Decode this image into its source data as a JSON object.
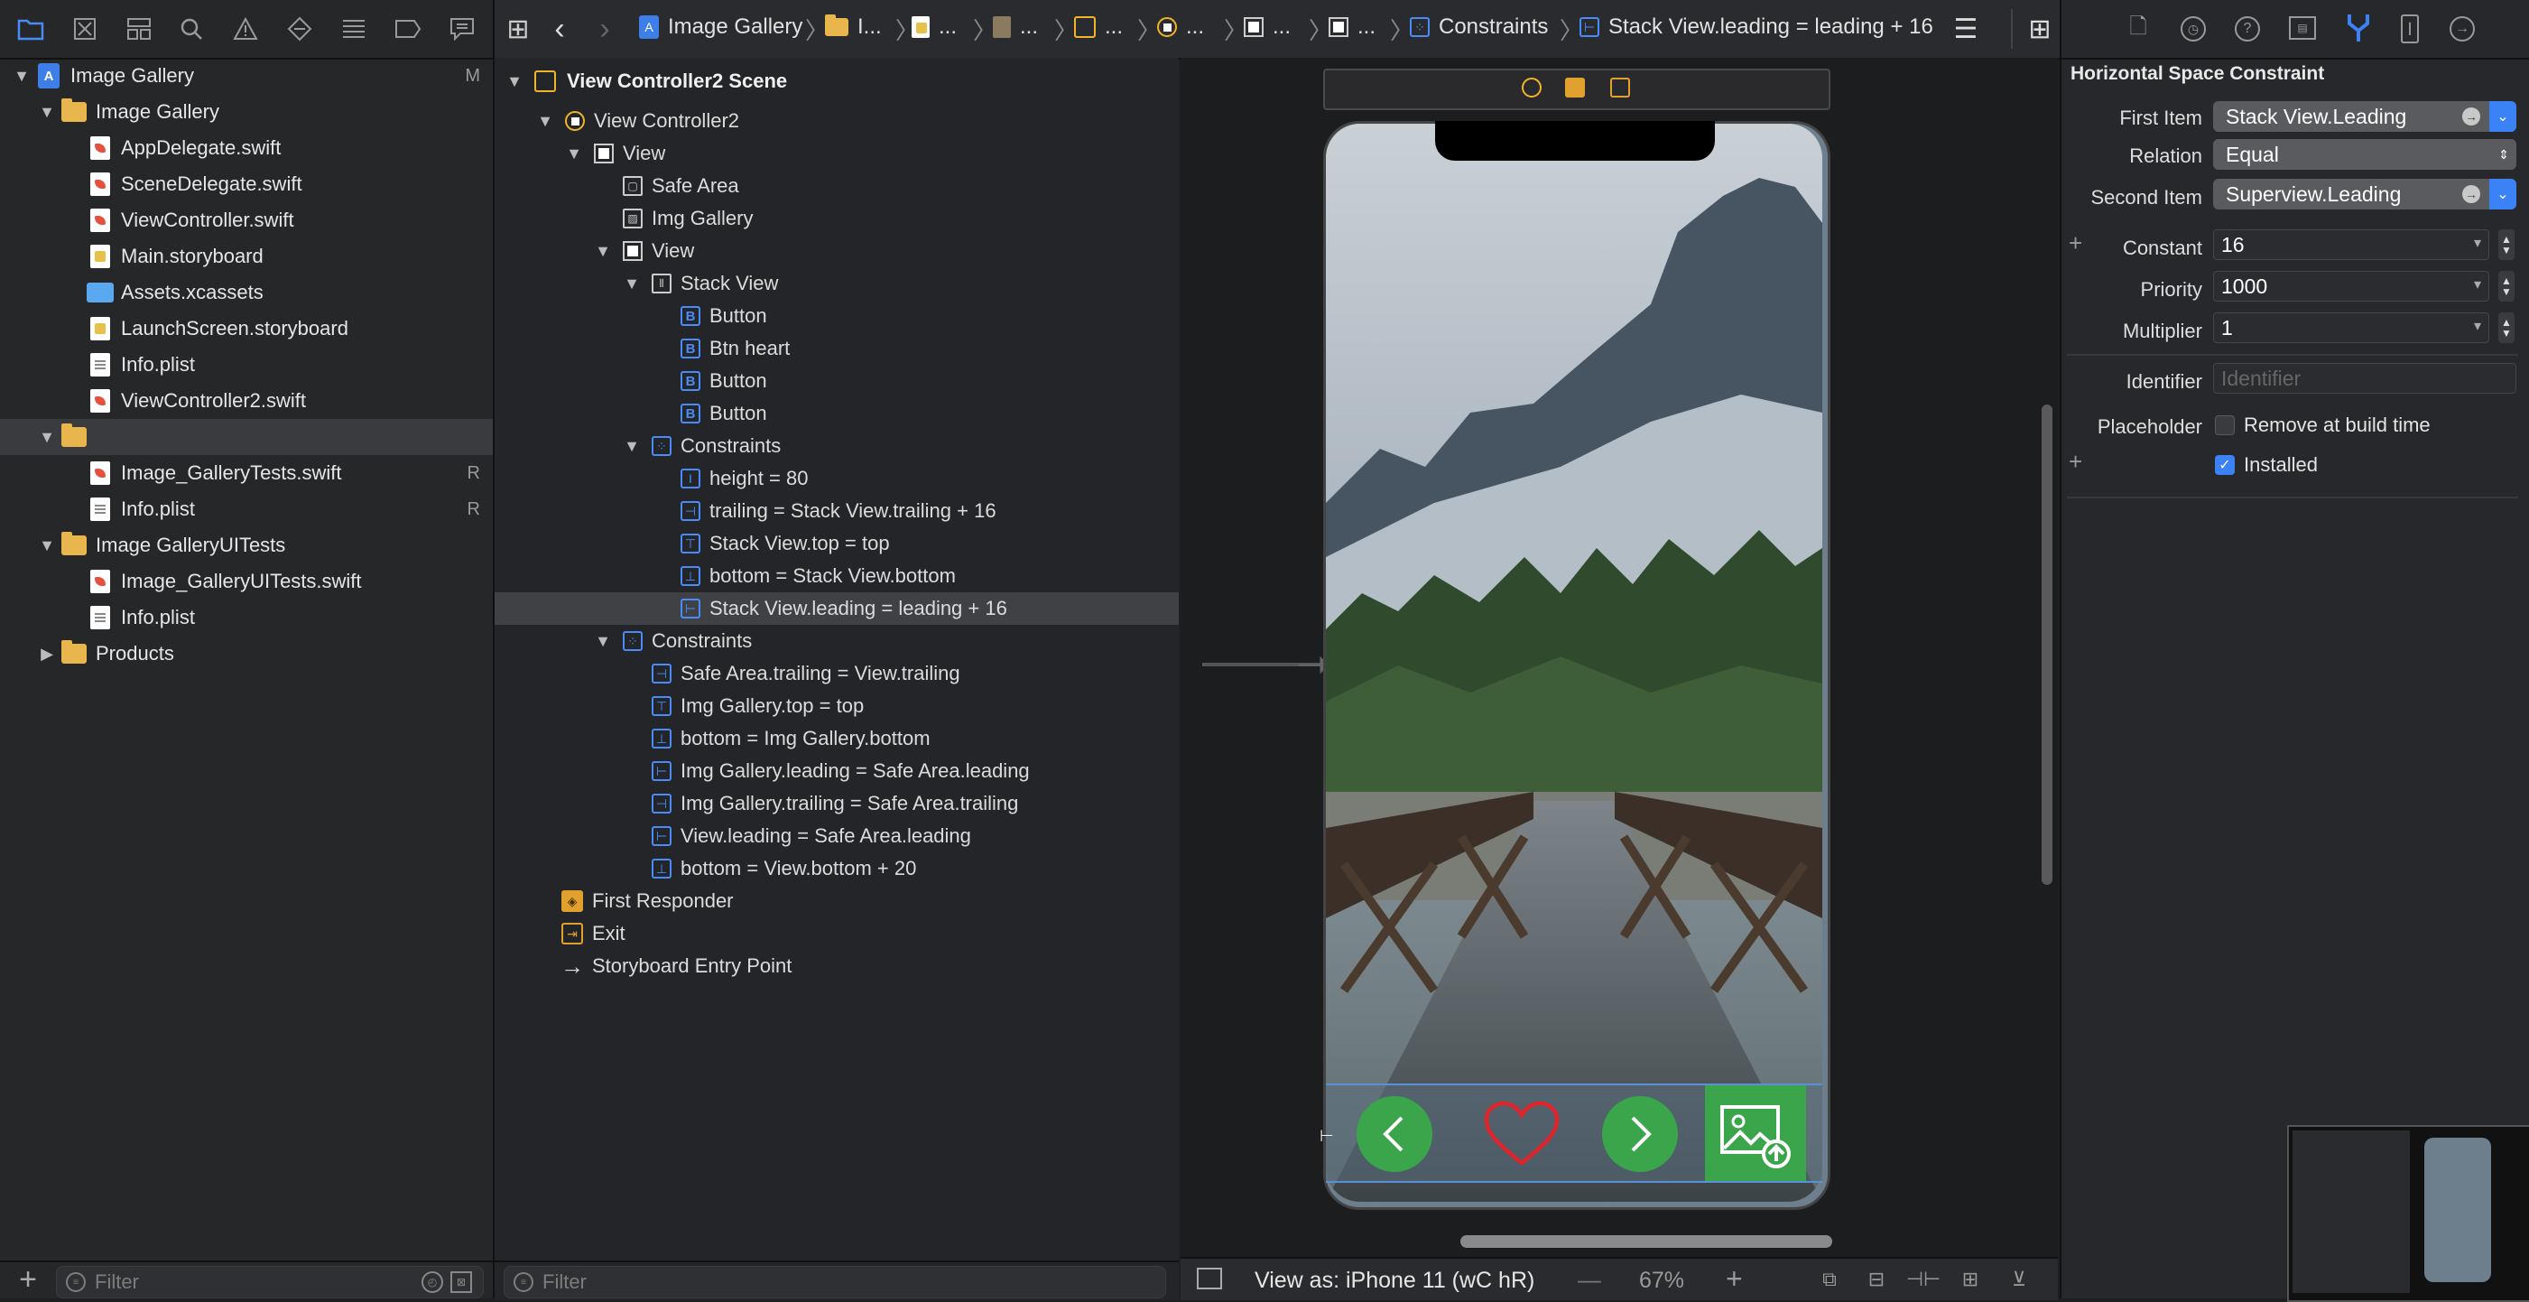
{
  "navigator": {
    "toolbar_icons": [
      "folder-icon",
      "source-control-icon",
      "symbol-icon",
      "find-icon",
      "issue-icon",
      "test-icon",
      "debug-icon",
      "breakpoint-icon",
      "report-icon"
    ],
    "items": [
      {
        "label": "Image Gallery",
        "badge": "M",
        "type": "project"
      },
      {
        "label": "Image Gallery",
        "badge": "",
        "type": "folder"
      },
      {
        "label": "AppDelegate.swift",
        "badge": "",
        "type": "swift"
      },
      {
        "label": "SceneDelegate.swift",
        "badge": "",
        "type": "swift"
      },
      {
        "label": "ViewController.swift",
        "badge": "",
        "type": "swift"
      },
      {
        "label": "Main.storyboard",
        "badge": "",
        "type": "storyboard"
      },
      {
        "label": "Assets.xcassets",
        "badge": "",
        "type": "assets"
      },
      {
        "label": "LaunchScreen.storyboard",
        "badge": "",
        "type": "storyboard"
      },
      {
        "label": "Info.plist",
        "badge": "",
        "type": "plist"
      },
      {
        "label": "ViewController2.swift",
        "badge": "",
        "type": "swift"
      },
      {
        "label": "",
        "badge": "",
        "type": "folder"
      },
      {
        "label": "Image_GalleryTests.swift",
        "badge": "R",
        "type": "swift"
      },
      {
        "label": "Info.plist",
        "badge": "R",
        "type": "plist"
      },
      {
        "label": "Image GalleryUITests",
        "badge": "",
        "type": "folder"
      },
      {
        "label": "Image_GalleryUITests.swift",
        "badge": "",
        "type": "swift"
      },
      {
        "label": "Info.plist",
        "badge": "",
        "type": "plist"
      },
      {
        "label": "Products",
        "badge": "",
        "type": "folder"
      }
    ],
    "filter_placeholder": "Filter"
  },
  "jumpbar": {
    "crumbs": [
      "Image Gallery",
      "I...",
      "...",
      "...",
      "...",
      "...",
      "...",
      "...",
      "Constraints",
      "Stack View.leading = leading + 16"
    ]
  },
  "outline": {
    "items": [
      {
        "label": "View Controller2 Scene",
        "type": "scene"
      },
      {
        "label": "View Controller2",
        "type": "vc"
      },
      {
        "label": "View",
        "type": "view"
      },
      {
        "label": "Safe Area",
        "type": "generic"
      },
      {
        "label": "Img Gallery",
        "type": "image"
      },
      {
        "label": "View",
        "type": "view"
      },
      {
        "label": "Stack View",
        "type": "stack"
      },
      {
        "label": "Button",
        "type": "button"
      },
      {
        "label": "Btn heart",
        "type": "button"
      },
      {
        "label": "Button",
        "type": "button"
      },
      {
        "label": "Button",
        "type": "button"
      },
      {
        "label": "Constraints",
        "type": "constraints"
      },
      {
        "label": "height = 80",
        "type": "constraint"
      },
      {
        "label": "trailing = Stack View.trailing + 16",
        "type": "constraint"
      },
      {
        "label": "Stack View.top = top",
        "type": "constraint"
      },
      {
        "label": "bottom = Stack View.bottom",
        "type": "constraint"
      },
      {
        "label": "Stack View.leading = leading + 16",
        "type": "constraint"
      },
      {
        "label": "Constraints",
        "type": "constraints"
      },
      {
        "label": "Safe Area.trailing = View.trailing",
        "type": "constraint"
      },
      {
        "label": "Img Gallery.top = top",
        "type": "constraint"
      },
      {
        "label": "bottom = Img Gallery.bottom",
        "type": "constraint"
      },
      {
        "label": "Img Gallery.leading = Safe Area.leading",
        "type": "constraint"
      },
      {
        "label": "Img Gallery.trailing = Safe Area.trailing",
        "type": "constraint"
      },
      {
        "label": "View.leading = Safe Area.leading",
        "type": "constraint"
      },
      {
        "label": "bottom = View.bottom + 20",
        "type": "constraint"
      },
      {
        "label": "First Responder",
        "type": "responder"
      },
      {
        "label": "Exit",
        "type": "exit"
      },
      {
        "label": "Storyboard Entry Point",
        "type": "entry"
      }
    ],
    "filter_placeholder": "Filter"
  },
  "canvas": {
    "view_as": "View as: iPhone 11 (wC hR)",
    "zoom_minus": "—",
    "zoom": "67%",
    "zoom_plus": "+"
  },
  "inspector": {
    "section_title": "Horizontal Space Constraint",
    "first_item_label": "First Item",
    "first_item_value": "Stack View.Leading",
    "relation_label": "Relation",
    "relation_value": "Equal",
    "second_item_label": "Second Item",
    "second_item_value": "Superview.Leading",
    "constant_label": "Constant",
    "constant_value": "16",
    "priority_label": "Priority",
    "priority_value": "1000",
    "multiplier_label": "Multiplier",
    "multiplier_value": "1",
    "identifier_label": "Identifier",
    "identifier_placeholder": "Identifier",
    "placeholder_label": "Placeholder",
    "placeholder_option": "Remove at build time",
    "placeholder_checked": false,
    "installed_label": "Installed",
    "installed_checked": true
  },
  "colors": {
    "accent": "#4a8cf7",
    "folder": "#e8b64c",
    "button_green": "#3aa54a",
    "heart": "#e0242b"
  }
}
